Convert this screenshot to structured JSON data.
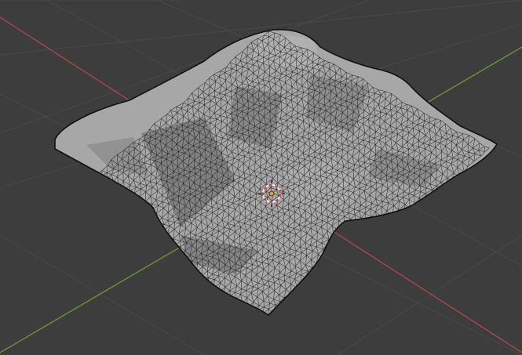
{
  "viewport": {
    "background_color": "#3d3d3d",
    "grid_color": "#4a4a4a",
    "x_axis_color": "#b2474e",
    "y_axis_color": "#6e9c31"
  },
  "mesh": {
    "object_type": "terrain",
    "face_color": "#a7a7a7",
    "wire_color": "#1a1a1a",
    "outline_color": "#101010"
  },
  "cursor_3d": {
    "icon": "3d-cursor-icon",
    "ring_red": "#d93d3d",
    "ring_white": "#f2f2f2",
    "origin_color": "#e49a1f"
  }
}
